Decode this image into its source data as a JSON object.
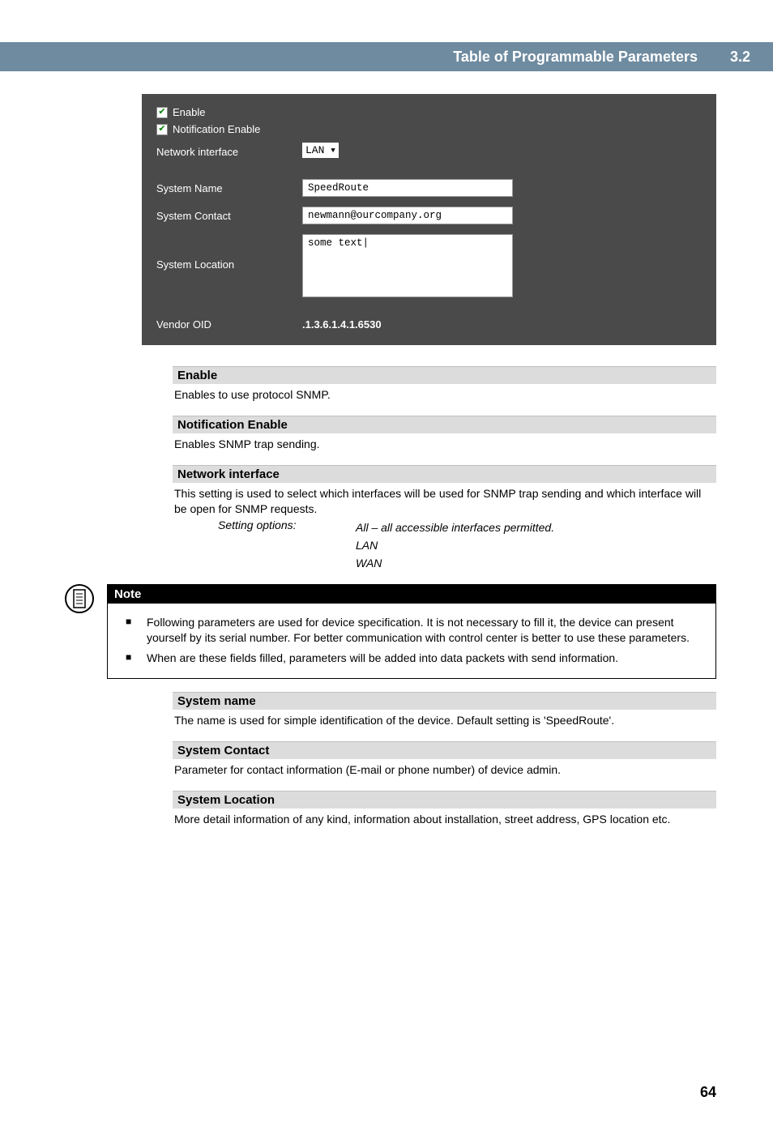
{
  "header": {
    "title": "Table of Programmable Parameters",
    "section": "3.2"
  },
  "config": {
    "enable_label": "Enable",
    "notification_enable_label": "Notification Enable",
    "network_interface_label": "Network interface",
    "network_interface_value": "LAN",
    "system_name_label": "System Name",
    "system_name_value": "SpeedRoute",
    "system_contact_label": "System Contact",
    "system_contact_value": "newmann@ourcompany.org",
    "system_location_label": "System Location",
    "system_location_value": "some text|",
    "vendor_oid_label": "Vendor OID",
    "vendor_oid_value": ".1.3.6.1.4.1.6530"
  },
  "sections": {
    "enable": {
      "heading": "Enable",
      "body": "Enables to use protocol SNMP."
    },
    "notification_enable": {
      "heading": "Notification Enable",
      "body": "Enables SNMP trap sending."
    },
    "network_interface": {
      "heading": "Network interface",
      "body": "This setting is used to select which interfaces will be used for SNMP trap sending and which interface will be open for SNMP requests.",
      "setting_label": "Setting options:",
      "opt1": "All – all accessible interfaces permitted.",
      "opt2": "LAN",
      "opt3": "WAN"
    },
    "system_name": {
      "heading": "System name",
      "body": "The name is used for simple identification of the device. Default setting is 'SpeedRoute'."
    },
    "system_contact": {
      "heading": "System Contact",
      "body": "Parameter for contact information (E-mail or phone number) of device admin."
    },
    "system_location": {
      "heading": "System Location",
      "body": "More detail information of any kind, information about installation, street address, GPS location etc."
    }
  },
  "note": {
    "label": "Note",
    "item1": "Following parameters are used for device specification. It is not necessary to fill it, the device can present yourself by its serial number. For better communication with control center is better to use these parameters.",
    "item2": "When are these fields filled, parameters will be added into data packets with send information."
  },
  "page_number": "64"
}
